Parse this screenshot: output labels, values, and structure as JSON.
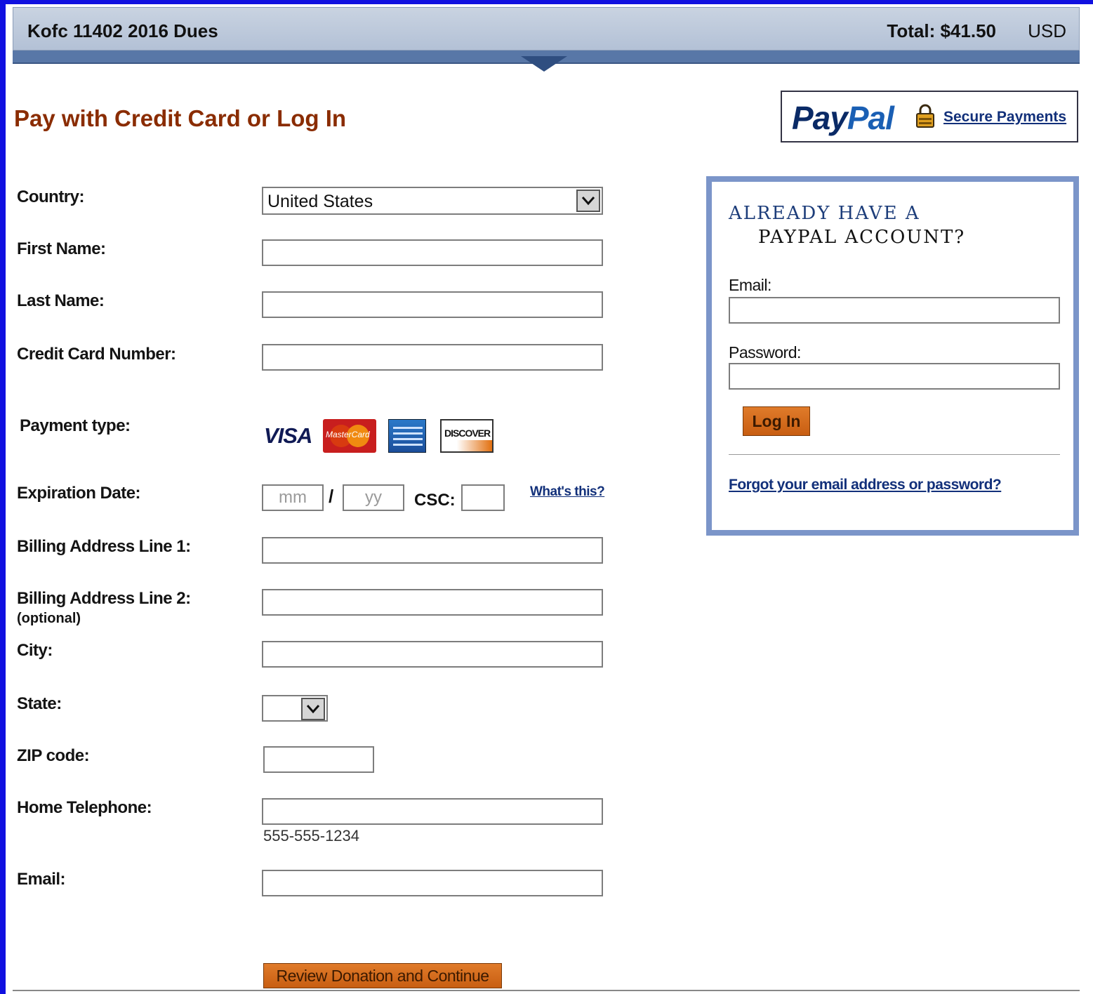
{
  "header": {
    "title": "Kofc 11402 2016 Dues",
    "total": "Total: $41.50",
    "currency": "USD"
  },
  "page_title": "Pay with Credit Card or Log In",
  "paypal_badge": {
    "logo_pay": "Pay",
    "logo_pal": "Pal",
    "secure_link": "Secure Payments"
  },
  "form": {
    "country": {
      "label": "Country:",
      "value": "United States"
    },
    "first_name": {
      "label": "First Name:",
      "value": ""
    },
    "last_name": {
      "label": "Last Name:",
      "value": ""
    },
    "card_number": {
      "label": "Credit Card Number:",
      "value": ""
    },
    "payment_type": {
      "label": "Payment type:",
      "cards": {
        "visa": "VISA",
        "mastercard": "MasterCard",
        "discover": "DISCOVER"
      }
    },
    "expiration": {
      "label": "Expiration Date:",
      "mm_placeholder": "mm",
      "separator": "/",
      "yy_placeholder": "yy",
      "csc_label": "CSC:",
      "whats_this": "What's this?"
    },
    "address1": {
      "label": "Billing Address Line 1:",
      "value": ""
    },
    "address2": {
      "label": "Billing Address Line 2:",
      "sublabel": "(optional)",
      "value": ""
    },
    "city": {
      "label": "City:",
      "value": ""
    },
    "state": {
      "label": "State:",
      "value": ""
    },
    "zip": {
      "label": "ZIP code:",
      "value": ""
    },
    "phone": {
      "label": "Home Telephone:",
      "hint": "555-555-1234",
      "value": ""
    },
    "email": {
      "label": "Email:",
      "value": ""
    },
    "submit_label": "Review Donation and Continue"
  },
  "login_panel": {
    "heading_line1": "ALREADY HAVE A",
    "heading_line2": "PAYPAL ACCOUNT?",
    "email_label": "Email:",
    "password_label": "Password:",
    "login_button": "Log In",
    "forgot_link": "Forgot your email address or password?"
  },
  "colors": {
    "frame": "#1010e0",
    "header_bg": "#c3cede",
    "title": "#8a2c00",
    "link": "#12307a",
    "button": "#d56a1c",
    "panel_border": "#7b95c9"
  }
}
